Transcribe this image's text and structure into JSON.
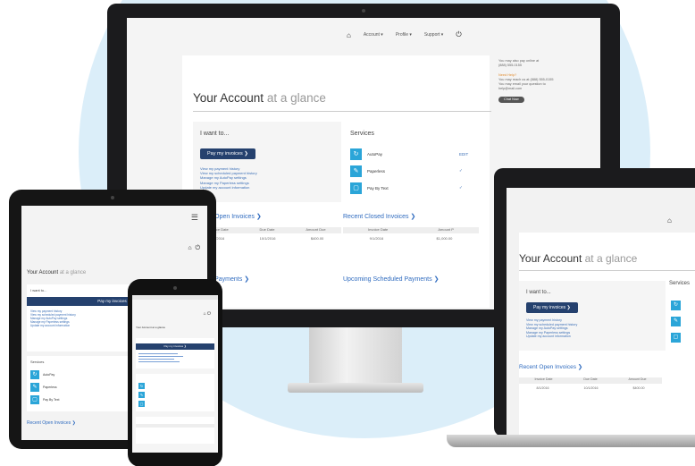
{
  "nav": {
    "home_icon": "home-icon",
    "account": "Account ▾",
    "profile": "Profile ▾",
    "support": "Support ▾",
    "logout_icon": "power-icon"
  },
  "account": {
    "title_main": "Your Account",
    "title_rest": "at a glance"
  },
  "iwant": {
    "heading": "I want to...",
    "button": "Pay my invoices",
    "links": [
      "View my payment history",
      "View my scheduled payment history",
      "Manage my AutoPay settings",
      "Manage my Paperless settings",
      "Update my account information"
    ]
  },
  "services": {
    "heading": "Services",
    "items": [
      {
        "icon": "autopay-icon",
        "name": "AutoPay",
        "state": "EDIT"
      },
      {
        "icon": "paperless-icon",
        "name": "Paperless",
        "state": "✓"
      },
      {
        "icon": "paybytext-icon",
        "name": "Pay By Text",
        "state": "✓"
      }
    ]
  },
  "recent_open": {
    "title": "Recent Open Invoices",
    "columns": [
      "Invoice Date",
      "Due Date",
      "Amount Due"
    ],
    "rows": [
      [
        "8/1/2016",
        "10/1/2016",
        "$400.00"
      ]
    ]
  },
  "recent_closed": {
    "title": "Recent Closed Invoices",
    "columns": [
      "Invoice Date",
      "Amount P"
    ],
    "rows": [
      [
        "9/1/2016",
        "$1,000.00"
      ]
    ]
  },
  "scheduled": {
    "title": "Upcoming Scheduled Payments",
    "recent_payments": "Recent Payments"
  },
  "side": {
    "line1": "You may also pay online at",
    "line2": "(888) 555-0155",
    "alert": "Need Help?",
    "line3": "You may reach us at (888) 555-0155",
    "line4": "You may email your question to",
    "line5": "help@mail.com",
    "button": "Chat Now"
  },
  "tablet": {
    "title_main": "Your Account",
    "title_rest": "at a glance",
    "iwant": "I want to...",
    "button": "Pay my invoices",
    "services": "Services",
    "recent_open": "Recent Open Invoices"
  },
  "phone": {
    "title": "Your Account at a glance",
    "button": "Pay my invoices"
  }
}
